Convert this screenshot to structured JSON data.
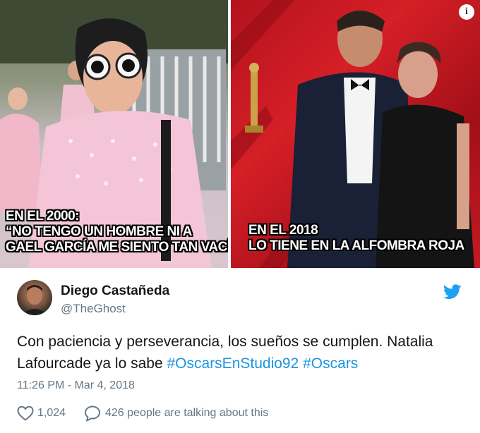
{
  "media": {
    "left_caption": [
      "EN EL 2000:",
      "“NO TENGO UN HOMBRE NI A",
      "GAEL GARCÍA ME SIENTO TAN VACÍA”"
    ],
    "right_caption": [
      "EN EL 2018",
      "LO TIENE EN LA ALFOMBRA ROJA"
    ],
    "info_icon": "info-icon",
    "info_glyph": "i"
  },
  "author": {
    "name": "Diego Castañeda",
    "handle": "@TheGhost",
    "bird_icon": "twitter-bird-icon",
    "brand_color": "#1da1f2"
  },
  "tweet": {
    "text": "Con paciencia y perseverancia, los sueños se cumplen. Natalia Lafourcade ya lo sabe",
    "hashtags": [
      "#OscarsEnStudio92",
      "#Oscars"
    ],
    "hashtag_color": "#1b95e0"
  },
  "timestamp": "11:26 PM - Mar 4, 2018",
  "actions": {
    "like_count": "1,024",
    "like_icon": "heart-icon",
    "reply_text": "426 people are talking about this",
    "reply_icon": "speech-bubble-icon"
  }
}
